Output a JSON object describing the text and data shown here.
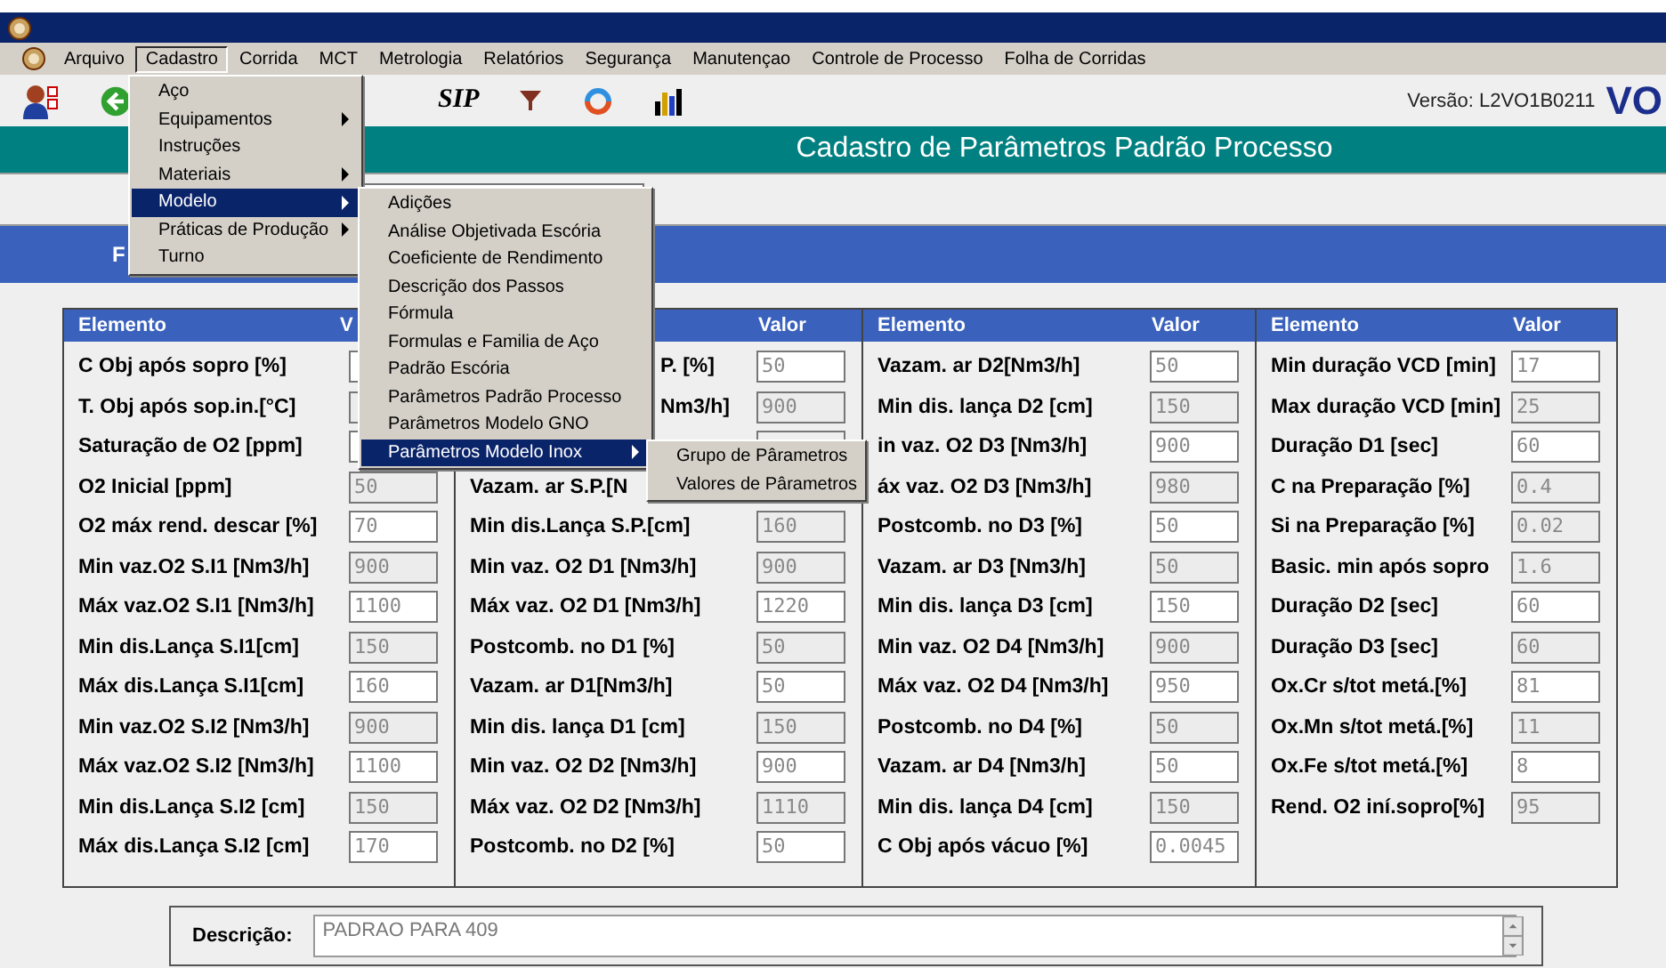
{
  "menubar": [
    {
      "label": "Arquivo",
      "selected": false
    },
    {
      "label": "Cadastro",
      "selected": true
    },
    {
      "label": "Corrida",
      "selected": false
    },
    {
      "label": "MCT",
      "selected": false
    },
    {
      "label": "Metrologia",
      "selected": false
    },
    {
      "label": "Relatórios",
      "selected": false
    },
    {
      "label": "Segurança",
      "selected": false
    },
    {
      "label": "Manutençao",
      "selected": false
    },
    {
      "label": "Controle de Processo",
      "selected": false
    },
    {
      "label": "Folha de Corridas",
      "selected": false
    }
  ],
  "toolbar": {
    "sip": "SIP",
    "version": "Versão: L2VO1B0211",
    "logo": "VO"
  },
  "form_title": "Cadastro de Parâmetros Padrão Processo",
  "band_label": "F",
  "columns": [
    {
      "header": {
        "element": "Elemento",
        "value": "V"
      },
      "rows": [
        {
          "label": "C Obj após sopro [%]",
          "enabled": true
        },
        {
          "label": "T. Obj após sop.in.[°C]",
          "enabled": false
        },
        {
          "label": "Saturação de O2 [ppm]",
          "enabled": true
        },
        {
          "label": "O2 Inicial [ppm]",
          "value": "50",
          "enabled": false
        },
        {
          "label": "O2 máx rend. descar [%]",
          "value": "70",
          "enabled": true
        },
        {
          "label": "Min vaz.O2 S.I1 [Nm3/h]",
          "value": "900",
          "enabled": false
        },
        {
          "label": "Máx vaz.O2 S.I1 [Nm3/h]",
          "value": "1100",
          "enabled": true
        },
        {
          "label": "Min dis.Lança S.I1[cm]",
          "value": "150",
          "enabled": false
        },
        {
          "label": "Máx  dis.Lança S.I1[cm]",
          "value": "160",
          "enabled": true
        },
        {
          "label": "Min vaz.O2 S.I2 [Nm3/h]",
          "value": "900",
          "enabled": false
        },
        {
          "label": "Máx vaz.O2 S.I2 [Nm3/h]",
          "value": "1100",
          "enabled": true
        },
        {
          "label": "Min dis.Lança S.I2 [cm]",
          "value": "150",
          "enabled": false
        },
        {
          "label": "Máx  dis.Lança S.I2 [cm]",
          "value": "170",
          "enabled": true
        }
      ]
    },
    {
      "header": {
        "value": "Valor"
      },
      "rows": [
        {
          "label": "P. [%]",
          "cut_left": true,
          "value": "50",
          "enabled": true
        },
        {
          "label": "Nm3/h]",
          "cut_left": true,
          "value": "900",
          "enabled": false
        },
        {},
        {
          "label": "Vazam. ar S.P.[N"
        },
        {
          "label": "Min dis.Lança S.P.[cm]",
          "value": "160",
          "enabled": false
        },
        {
          "label": "Min vaz. O2 D1 [Nm3/h]",
          "value": "900",
          "enabled": false
        },
        {
          "label": "Máx  vaz. O2 D1 [Nm3/h]",
          "value": "1220",
          "enabled": true
        },
        {
          "label": "Postcomb. no D1 [%]",
          "value": "50",
          "enabled": false
        },
        {
          "label": "Vazam. ar D1[Nm3/h]",
          "value": "50",
          "enabled": true
        },
        {
          "label": "Min dis. lança D1 [cm]",
          "value": "150",
          "enabled": false
        },
        {
          "label": "Min  vaz. O2 D2 [Nm3/h]",
          "value": "900",
          "enabled": true
        },
        {
          "label": "Máx  vaz. O2 D2 [Nm3/h]",
          "value": "1110",
          "enabled": false
        },
        {
          "label": "Postcomb. no D2 [%]",
          "value": "50",
          "enabled": true
        }
      ]
    },
    {
      "header": {
        "element": "Elemento",
        "value": "Valor"
      },
      "rows": [
        {
          "label": "Vazam. ar D2[Nm3/h]",
          "value": "50",
          "enabled": true
        },
        {
          "label": "Min dis. lança D2 [cm]",
          "value": "150",
          "enabled": false
        },
        {
          "label": "in vaz. O2 D3 [Nm3/h]",
          "value": "900",
          "enabled": true
        },
        {
          "label": "áx  vaz. O2 D3 [Nm3/h]",
          "value": "980",
          "enabled": false
        },
        {
          "label": "Postcomb. no D3 [%]",
          "value": "50",
          "enabled": true
        },
        {
          "label": "Vazam. ar D3 [Nm3/h]",
          "value": "50",
          "enabled": false
        },
        {
          "label": "Min dis. lança D3 [cm]",
          "value": "150",
          "enabled": true
        },
        {
          "label": "Min  vaz. O2 D4 [Nm3/h]",
          "value": "900",
          "enabled": false
        },
        {
          "label": "Máx  vaz. O2 D4 [Nm3/h]",
          "value": "950",
          "enabled": true
        },
        {
          "label": "Postcomb. no D4 [%]",
          "value": "50",
          "enabled": false
        },
        {
          "label": "Vazam. ar D4 [Nm3/h]",
          "value": "50",
          "enabled": true
        },
        {
          "label": "Min dis. lança D4 [cm]",
          "value": "150",
          "enabled": false
        },
        {
          "label": "C Obj após vácuo [%]",
          "value": "0.0045",
          "enabled": true
        }
      ]
    },
    {
      "header": {
        "element": "Elemento",
        "value": "Valor"
      },
      "rows": [
        {
          "label": "Min duração VCD [min]",
          "value": "17",
          "enabled": true
        },
        {
          "label": "Max duração VCD [min]",
          "value": "25",
          "enabled": false
        },
        {
          "label": "Duração D1 [sec]",
          "value": "60",
          "enabled": true
        },
        {
          "label": "C na Preparação [%]",
          "value": "0.4",
          "enabled": false
        },
        {
          "label": "Si  na Preparação [%]",
          "value": "0.02",
          "enabled": false
        },
        {
          "label": "Basic. min após sopro",
          "value": "1.6",
          "enabled": false
        },
        {
          "label": "Duração D2 [sec]",
          "value": "60",
          "enabled": true
        },
        {
          "label": "Duração D3 [sec]",
          "value": "60",
          "enabled": false
        },
        {
          "label": "Ox.Cr s/tot metá.[%]",
          "value": "81",
          "enabled": true
        },
        {
          "label": "Ox.Mn s/tot metá.[%]",
          "value": "11",
          "enabled": false
        },
        {
          "label": "Ox.Fe s/tot metá.[%]",
          "value": "8",
          "enabled": true
        },
        {
          "label": "Rend. O2 iní.sopro[%]",
          "value": "95",
          "enabled": false
        }
      ]
    }
  ],
  "description": {
    "label": "Descrição:",
    "value": "PADRAO PARA 409"
  },
  "cadastro_menu": [
    {
      "label": "Aço",
      "submenu": false,
      "selected": false
    },
    {
      "label": "Equipamentos",
      "submenu": true,
      "selected": false
    },
    {
      "label": "Instruções",
      "submenu": false,
      "selected": false
    },
    {
      "label": "Materiais",
      "submenu": true,
      "selected": false
    },
    {
      "label": "Modelo",
      "submenu": true,
      "selected": true
    },
    {
      "label": "Práticas de Produção",
      "submenu": true,
      "selected": false
    },
    {
      "label": "Turno",
      "submenu": false,
      "selected": false
    }
  ],
  "modelo_menu": [
    {
      "label": "Adições",
      "submenu": false,
      "selected": false
    },
    {
      "label": "Análise Objetivada Escória",
      "submenu": false,
      "selected": false
    },
    {
      "label": "Coeficiente de Rendimento",
      "submenu": false,
      "selected": false
    },
    {
      "label": "Descrição dos Passos",
      "submenu": false,
      "selected": false
    },
    {
      "label": "Fórmula",
      "submenu": false,
      "selected": false
    },
    {
      "label": "Formulas e Familia de Aço",
      "submenu": false,
      "selected": false
    },
    {
      "label": "Padrão Escória",
      "submenu": false,
      "selected": false
    },
    {
      "label": "Parâmetros Padrão Processo",
      "submenu": false,
      "selected": false
    },
    {
      "label": "Parâmetros Modelo GNO",
      "submenu": false,
      "selected": false
    },
    {
      "label": "Parâmetros Modelo Inox",
      "submenu": true,
      "selected": true
    }
  ],
  "inox_menu": [
    {
      "label": "Grupo de Pârametros",
      "selected": false
    },
    {
      "label": "Valores de Pârametros",
      "selected": false
    }
  ]
}
